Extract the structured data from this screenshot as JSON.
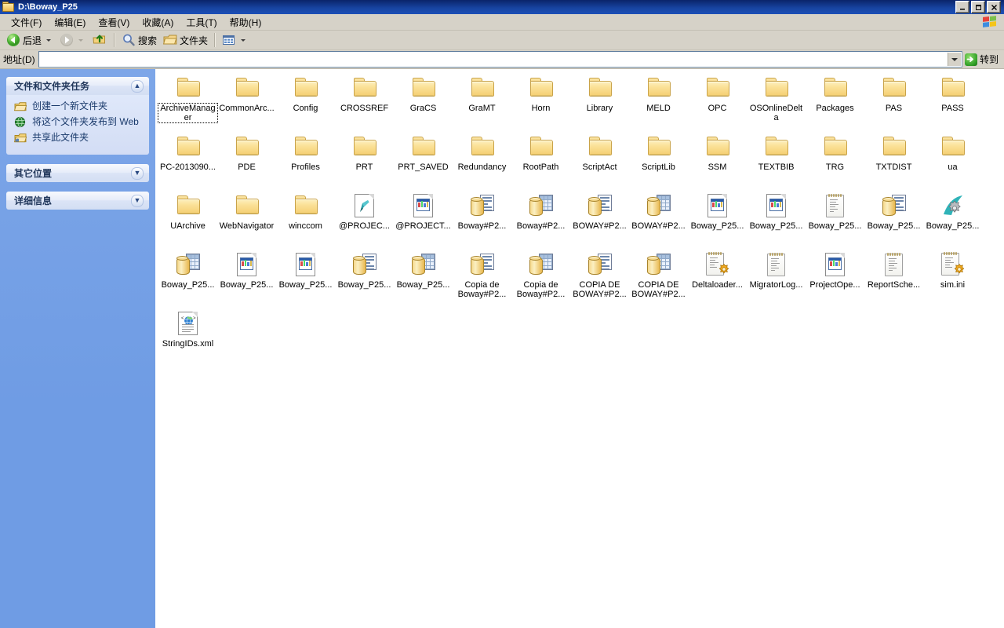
{
  "window": {
    "title": "D:\\Boway_P25",
    "icon": "folder-icon",
    "minimize_label": "_",
    "maximize_label": "□",
    "close_label": "×"
  },
  "menubar": {
    "items": [
      {
        "label": "文件(F)",
        "name": "menu-file"
      },
      {
        "label": "编辑(E)",
        "name": "menu-edit"
      },
      {
        "label": "查看(V)",
        "name": "menu-view"
      },
      {
        "label": "收藏(A)",
        "name": "menu-favorites"
      },
      {
        "label": "工具(T)",
        "name": "menu-tools"
      },
      {
        "label": "帮助(H)",
        "name": "menu-help"
      }
    ],
    "brand_icon": "windows-flag-icon"
  },
  "toolbar": {
    "back_label": "后退",
    "back_icon": "back-arrow-icon",
    "forward_icon": "forward-arrow-icon",
    "up_icon": "up-folder-icon",
    "search_label": "搜索",
    "search_icon": "magnifier-icon",
    "folders_label": "文件夹",
    "folders_icon": "folder-icon",
    "views_icon": "views-icon"
  },
  "address": {
    "label": "地址(D)",
    "value": "",
    "placeholder": "",
    "dropdown_icon": "chevron-down-icon",
    "go_label": "转到",
    "go_icon": "green-arrow-icon"
  },
  "sidebar": {
    "panels": [
      {
        "title": "文件和文件夹任务",
        "name": "panel-file-folder-tasks",
        "chevron": "▲",
        "expanded": true,
        "tasks": [
          {
            "label": "创建一个新文件夹",
            "icon": "new-folder-icon",
            "name": "task-create-new-folder"
          },
          {
            "label": "将这个文件夹发布到 Web",
            "icon": "publish-web-icon",
            "name": "task-publish-to-web"
          },
          {
            "label": "共享此文件夹",
            "icon": "share-folder-icon",
            "name": "task-share-folder"
          }
        ]
      },
      {
        "title": "其它位置",
        "name": "panel-other-places",
        "chevron": "▼",
        "expanded": false,
        "tasks": []
      },
      {
        "title": "详细信息",
        "name": "panel-details",
        "chevron": "▼",
        "expanded": false,
        "tasks": []
      }
    ]
  },
  "content": {
    "items": [
      {
        "label": "ArchiveManager",
        "icon": "folder-icon",
        "type": "folder",
        "focused": true
      },
      {
        "label": "CommonArc...",
        "icon": "folder-icon",
        "type": "folder"
      },
      {
        "label": "Config",
        "icon": "folder-icon",
        "type": "folder"
      },
      {
        "label": "CROSSREF",
        "icon": "folder-icon",
        "type": "folder"
      },
      {
        "label": "GraCS",
        "icon": "folder-icon",
        "type": "folder"
      },
      {
        "label": "GraMT",
        "icon": "folder-icon",
        "type": "folder"
      },
      {
        "label": "Horn",
        "icon": "folder-icon",
        "type": "folder"
      },
      {
        "label": "Library",
        "icon": "folder-icon",
        "type": "folder"
      },
      {
        "label": "MELD",
        "icon": "folder-icon",
        "type": "folder"
      },
      {
        "label": "OPC",
        "icon": "folder-icon",
        "type": "folder"
      },
      {
        "label": "OSOnlineDelta",
        "icon": "folder-icon",
        "type": "folder"
      },
      {
        "label": "Packages",
        "icon": "folder-icon",
        "type": "folder"
      },
      {
        "label": "PAS",
        "icon": "folder-icon",
        "type": "folder"
      },
      {
        "label": "PASS",
        "icon": "folder-icon",
        "type": "folder"
      },
      {
        "label": "PC-2013090...",
        "icon": "folder-icon",
        "type": "folder"
      },
      {
        "label": "PDE",
        "icon": "folder-icon",
        "type": "folder"
      },
      {
        "label": "Profiles",
        "icon": "folder-icon",
        "type": "folder"
      },
      {
        "label": "PRT",
        "icon": "folder-icon",
        "type": "folder"
      },
      {
        "label": "PRT_SAVED",
        "icon": "folder-icon",
        "type": "folder"
      },
      {
        "label": "Redundancy",
        "icon": "folder-icon",
        "type": "folder"
      },
      {
        "label": "RootPath",
        "icon": "folder-icon",
        "type": "folder"
      },
      {
        "label": "ScriptAct",
        "icon": "folder-icon",
        "type": "folder"
      },
      {
        "label": "ScriptLib",
        "icon": "folder-icon",
        "type": "folder"
      },
      {
        "label": "SSM",
        "icon": "folder-icon",
        "type": "folder"
      },
      {
        "label": "TEXTBIB",
        "icon": "folder-icon",
        "type": "folder"
      },
      {
        "label": "TRG",
        "icon": "folder-icon",
        "type": "folder"
      },
      {
        "label": "TXTDIST",
        "icon": "folder-icon",
        "type": "folder"
      },
      {
        "label": "ua",
        "icon": "folder-icon",
        "type": "folder"
      },
      {
        "label": "UArchive",
        "icon": "folder-icon",
        "type": "folder"
      },
      {
        "label": "WebNavigator",
        "icon": "folder-icon",
        "type": "folder"
      },
      {
        "label": "winccom",
        "icon": "folder-icon",
        "type": "folder"
      },
      {
        "label": "@PROJEC...",
        "icon": "pen-document-icon",
        "type": "pen-doc"
      },
      {
        "label": "@PROJECT...",
        "icon": "window-document-icon",
        "type": "imgdoc"
      },
      {
        "label": "Boway#P2...",
        "icon": "database-text-icon",
        "type": "db-text"
      },
      {
        "label": "Boway#P2...",
        "icon": "database-grid-icon",
        "type": "db-grid"
      },
      {
        "label": "BOWAY#P2...",
        "icon": "database-text-icon",
        "type": "db-text"
      },
      {
        "label": "BOWAY#P2...",
        "icon": "database-grid-icon",
        "type": "db-grid"
      },
      {
        "label": "Boway_P25...",
        "icon": "window-document-icon",
        "type": "imgdoc"
      },
      {
        "label": "Boway_P25...",
        "icon": "window-document-icon",
        "type": "imgdoc"
      },
      {
        "label": "Boway_P25...",
        "icon": "notepad-icon",
        "type": "note"
      },
      {
        "label": "Boway_P25...",
        "icon": "database-text-icon",
        "type": "db-text"
      },
      {
        "label": "Boway_P25...",
        "icon": "gear-swoosh-icon",
        "type": "gear"
      },
      {
        "label": "Boway_P25...",
        "icon": "database-grid-icon",
        "type": "db-grid"
      },
      {
        "label": "Boway_P25...",
        "icon": "window-document-icon",
        "type": "imgdoc"
      },
      {
        "label": "Boway_P25...",
        "icon": "window-document-icon",
        "type": "imgdoc"
      },
      {
        "label": "Boway_P25...",
        "icon": "database-text-icon",
        "type": "db-text"
      },
      {
        "label": "Boway_P25...",
        "icon": "database-grid-icon",
        "type": "db-grid"
      },
      {
        "label": "Copia de Boway#P2...",
        "icon": "database-text-icon",
        "type": "db-text"
      },
      {
        "label": "Copia de Boway#P2...",
        "icon": "database-grid-icon",
        "type": "db-grid"
      },
      {
        "label": "COPIA DE BOWAY#P2...",
        "icon": "database-text-icon",
        "type": "db-text"
      },
      {
        "label": "COPIA DE BOWAY#P2...",
        "icon": "database-grid-icon",
        "type": "db-grid"
      },
      {
        "label": "Deltaloader...",
        "icon": "notepad-gear-icon",
        "type": "note-gear"
      },
      {
        "label": "MigratorLog...",
        "icon": "notepad-icon",
        "type": "note"
      },
      {
        "label": "ProjectOpe...",
        "icon": "window-document-icon",
        "type": "imgdoc"
      },
      {
        "label": "ReportSche...",
        "icon": "notepad-icon",
        "type": "note"
      },
      {
        "label": "sim.ini",
        "icon": "notepad-gear-icon",
        "type": "note-gear"
      },
      {
        "label": "StringIDs.xml",
        "icon": "xml-globe-icon",
        "type": "xml"
      }
    ]
  },
  "colors": {
    "titlebar": "#0a246a",
    "chrome": "#d6d2c8",
    "sidebar": "#6f9ce4",
    "panel_body": "#d9e3f8",
    "folder": "#f5cf72",
    "accent_green": "#2f9e26"
  }
}
